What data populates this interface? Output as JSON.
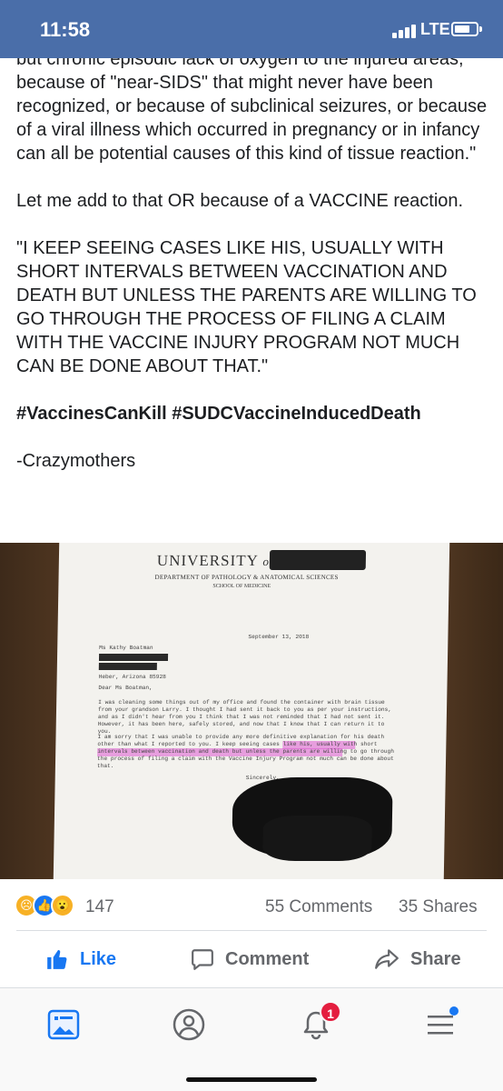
{
  "status_bar": {
    "time": "11:58",
    "network": "LTE"
  },
  "post": {
    "paragraphs": [
      "but chronic episodic lack of oxygen to the injured areas, because of \"near-SIDS\" that might never have been recognized, or because of subclinical seizures, or because of a viral illness which occurred in pregnancy or in infancy can all be potential causes of this kind of tissue reaction.\"",
      "Let me add to that OR because of a VACCINE reaction.",
      "\"I KEEP SEEING CASES LIKE HIS, USUALLY WITH SHORT INTERVALS BETWEEN VACCINATION AND DEATH BUT UNLESS THE PARENTS ARE WILLING TO GO THROUGH THE PROCESS OF FILING A CLAIM WITH THE VACCINE INJURY PROGRAM  NOT MUCH CAN BE DONE ABOUT THAT.\"",
      "#VaccinesCanKill #SUDCVaccineInducedDeath",
      "-Crazymothers"
    ]
  },
  "photo": {
    "letterhead": "UNIVERSITY",
    "letterhead_of": "of",
    "department": "DEPARTMENT OF PATHOLOGY & ANATOMICAL SCIENCES",
    "school": "SCHOOL OF MEDICINE",
    "date": "September 13, 2018",
    "recipient": "Ms Kathy Boatman",
    "city": "Heber, Arizona 85928",
    "greeting": "Dear Ms Boatman,",
    "para1": "I was cleaning some things out of my office and found the container with brain tissue from your grandson Larry. I thought I had sent it back to you as per your instructions, and as I didn't hear from you I think that I was not reminded that I had not sent it. However, it has been here, safely stored, and now that I know that I can return it to you.",
    "para2": "I am sorry that I was unable to provide any more definitive explanation for his death other than what I reported to you. I keep seeing cases like his, usually with short intervals between vaccination and death but unless the parents are willing to go through the process of filing a claim with the Vaccine Injury Program not much can be done about that.",
    "closing": "Sincerely,"
  },
  "engagement": {
    "reaction_count": "147",
    "comments": "55 Comments",
    "shares": "35 Shares"
  },
  "actions": {
    "like": "Like",
    "comment": "Comment",
    "share": "Share"
  },
  "bottom_nav": {
    "items": [
      "feed-icon",
      "profile-icon",
      "notifications-icon",
      "menu-icon"
    ],
    "notification_badge": "1"
  },
  "colors": {
    "status_bar": "#4a6ea9",
    "accent": "#1877f2",
    "badge": "#e41e3f"
  }
}
